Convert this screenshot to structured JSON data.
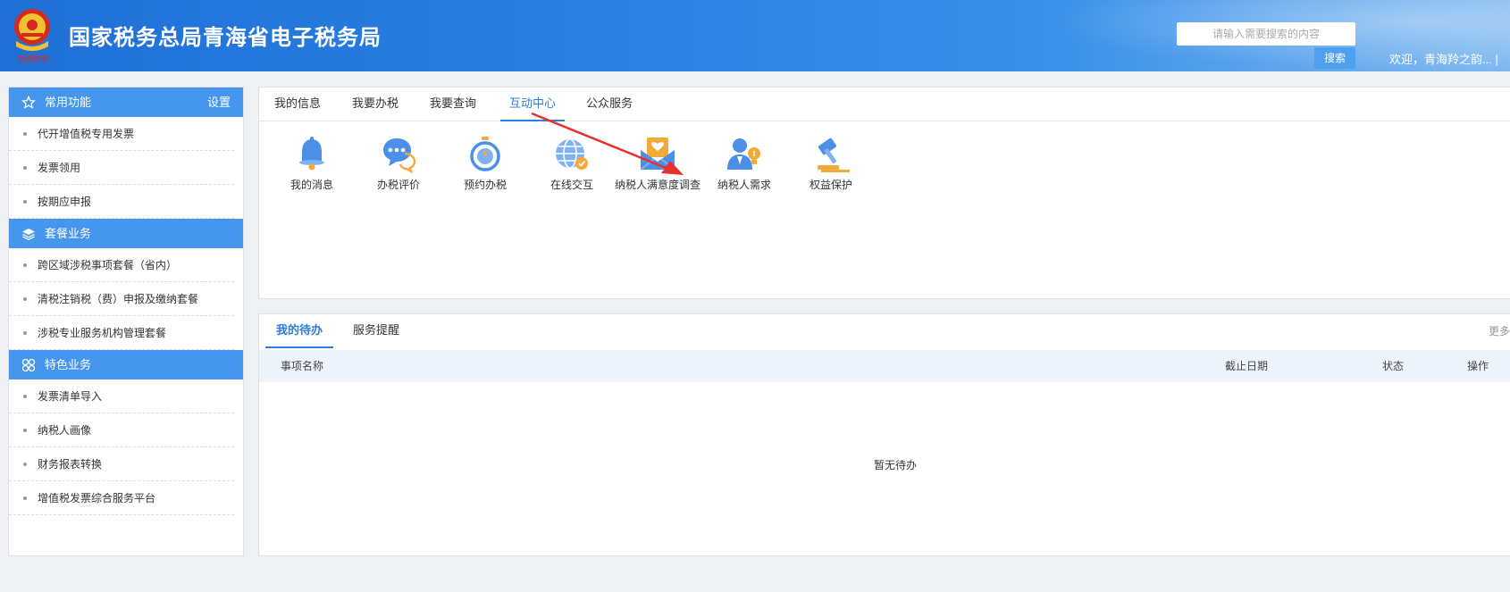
{
  "header": {
    "site_title": "国家税务总局青海省电子税务局",
    "search_placeholder": "请输入需要搜索的内容",
    "search_button": "搜索",
    "welcome_text": "欢迎，青海羚之韵...   |",
    "logo_caption": "中国税务"
  },
  "sidebar": {
    "sections": [
      {
        "title": "常用功能",
        "icon": "star-icon",
        "action": "设置",
        "items": [
          "代开增值税专用发票",
          "发票领用",
          "按期应申报"
        ]
      },
      {
        "title": "套餐业务",
        "icon": "layers-icon",
        "items": [
          "跨区域涉税事项套餐（省内）",
          "清税注销税（费）申报及缴纳套餐",
          "涉税专业服务机构管理套餐"
        ]
      },
      {
        "title": "特色业务",
        "icon": "grid-icon",
        "items": [
          "发票清单导入",
          "纳税人画像",
          "财务报表转换",
          "增值税发票综合服务平台"
        ]
      }
    ]
  },
  "main_tabs": [
    "我的信息",
    "我要办税",
    "我要查询",
    "互动中心",
    "公众服务"
  ],
  "active_tab": "互动中心",
  "functions": [
    {
      "label": "我的消息",
      "icon": "bell-icon"
    },
    {
      "label": "办税评价",
      "icon": "chat-icon"
    },
    {
      "label": "预约办税",
      "icon": "stopwatch-icon"
    },
    {
      "label": "在线交互",
      "icon": "globe-icon"
    },
    {
      "label": "纳税人满意度调查",
      "icon": "envelope-heart-icon"
    },
    {
      "label": "纳税人需求",
      "icon": "user-bulb-icon"
    },
    {
      "label": "权益保护",
      "icon": "gavel-icon"
    }
  ],
  "todo": {
    "tabs": [
      "我的待办",
      "服务提醒"
    ],
    "more": "更多",
    "columns": [
      "事项名称",
      "截止日期",
      "状态",
      "操作"
    ],
    "empty_text": "暂无待办"
  },
  "colors": {
    "header_blue": "#2a82e4",
    "sidebar_head": "#4596ec",
    "accent": "#2a7de1",
    "arrow": "#e8312f"
  }
}
